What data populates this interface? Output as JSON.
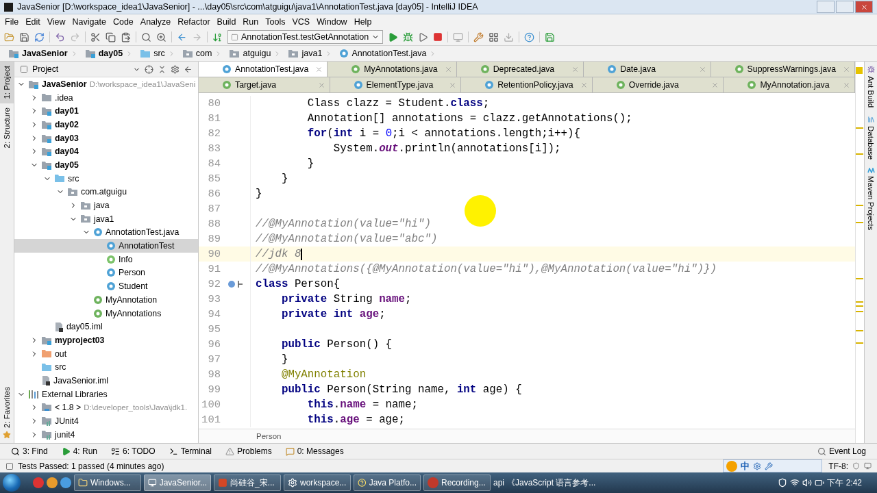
{
  "window": {
    "title": "JavaSenior [D:\\workspace_idea1\\JavaSenior] - ...\\day05\\src\\com\\atguigu\\java1\\AnnotationTest.java [day05] - IntelliJ IDEA"
  },
  "menu": [
    "File",
    "Edit",
    "View",
    "Navigate",
    "Code",
    "Analyze",
    "Refactor",
    "Build",
    "Run",
    "Tools",
    "VCS",
    "Window",
    "Help"
  ],
  "toolbar": {
    "run_config": "AnnotationTest.testGetAnnotation"
  },
  "nav_bar": [
    {
      "label": "JavaSenior",
      "kind": "module"
    },
    {
      "label": "day05",
      "kind": "module"
    },
    {
      "label": "src",
      "kind": "source"
    },
    {
      "label": "com",
      "kind": "package"
    },
    {
      "label": "atguigu",
      "kind": "package"
    },
    {
      "label": "java1",
      "kind": "package"
    },
    {
      "label": "AnnotationTest.java",
      "kind": "class"
    }
  ],
  "left_strip": {
    "top": [
      {
        "label": "1: Project",
        "selected": true
      },
      {
        "label": "2: Structure",
        "selected": false
      }
    ],
    "bottom": [
      {
        "label": "2: Favorites",
        "selected": false
      }
    ]
  },
  "project": {
    "title": "Project",
    "tree": [
      {
        "label": "JavaSenior",
        "kind": "module",
        "bold": true,
        "hint": "D:\\workspace_idea1\\JavaSeni",
        "expanded": true,
        "selected": false,
        "children": [
          {
            "label": ".idea",
            "kind": "folder",
            "expanded": false,
            "selected": false
          },
          {
            "label": "day01",
            "kind": "module",
            "bold": true,
            "expanded": false,
            "selected": false
          },
          {
            "label": "day02",
            "kind": "module",
            "bold": true,
            "expanded": false,
            "selected": false
          },
          {
            "label": "day03",
            "kind": "module",
            "bold": true,
            "expanded": false,
            "selected": false
          },
          {
            "label": "day04",
            "kind": "module",
            "bold": true,
            "expanded": false,
            "selected": false
          },
          {
            "label": "day05",
            "kind": "module",
            "bold": true,
            "expanded": true,
            "selected": false,
            "children": [
              {
                "label": "src",
                "kind": "source",
                "expanded": true,
                "selected": false,
                "children": [
                  {
                    "label": "com.atguigu",
                    "kind": "package",
                    "expanded": true,
                    "selected": false,
                    "children": [
                      {
                        "label": "java",
                        "kind": "package",
                        "expanded": false,
                        "selected": false
                      },
                      {
                        "label": "java1",
                        "kind": "package",
                        "expanded": true,
                        "selected": false,
                        "children": [
                          {
                            "label": "AnnotationTest.java",
                            "kind": "class",
                            "expanded": true,
                            "selected": false,
                            "children": [
                              {
                                "label": "AnnotationTest",
                                "kind": "class",
                                "selected": true
                              },
                              {
                                "label": "Info",
                                "kind": "interface",
                                "selected": false
                              },
                              {
                                "label": "Person",
                                "kind": "class",
                                "selected": false
                              },
                              {
                                "label": "Student",
                                "kind": "class",
                                "selected": false
                              }
                            ]
                          },
                          {
                            "label": "MyAnnotation",
                            "kind": "annotation",
                            "selected": false
                          },
                          {
                            "label": "MyAnnotations",
                            "kind": "annotation",
                            "selected": false
                          }
                        ]
                      }
                    ]
                  }
                ]
              },
              {
                "label": "day05.iml",
                "kind": "iml",
                "selected": false
              }
            ]
          },
          {
            "label": "myproject03",
            "kind": "module",
            "bold": true,
            "expanded": false,
            "selected": false
          },
          {
            "label": "out",
            "kind": "excluded",
            "expanded": false,
            "selected": false
          },
          {
            "label": "src",
            "kind": "source",
            "selected": false
          },
          {
            "label": "JavaSenior.iml",
            "kind": "iml",
            "selected": false
          }
        ]
      },
      {
        "label": "External Libraries",
        "kind": "libraries",
        "expanded": true,
        "selected": false,
        "children": [
          {
            "label": "< 1.8 >",
            "kind": "jdk",
            "hint": "D:\\developer_tools\\Java\\jdk1.",
            "expanded": false,
            "selected": false
          },
          {
            "label": "JUnit4",
            "kind": "library",
            "expanded": false,
            "selected": false
          },
          {
            "label": "junit4",
            "kind": "library",
            "expanded": false,
            "selected": false
          }
        ]
      }
    ]
  },
  "tab_rows": [
    [
      {
        "label": "AnnotationTest.java",
        "kind": "class",
        "selected": true
      },
      {
        "label": "MyAnnotations.java",
        "kind": "annotation",
        "selected": false
      },
      {
        "label": "Deprecated.java",
        "kind": "annotation",
        "selected": false
      },
      {
        "label": "Date.java",
        "kind": "class",
        "selected": false
      },
      {
        "label": "SuppressWarnings.java",
        "kind": "annotation",
        "selected": false
      }
    ],
    [
      {
        "label": "Target.java",
        "kind": "annotation",
        "selected": false
      },
      {
        "label": "ElementType.java",
        "kind": "enum",
        "selected": false
      },
      {
        "label": "RetentionPolicy.java",
        "kind": "enum",
        "selected": false
      },
      {
        "label": "Override.java",
        "kind": "annotation",
        "selected": false
      },
      {
        "label": "MyAnnotation.java",
        "kind": "annotation",
        "selected": false
      }
    ]
  ],
  "editor": {
    "lines": [
      {
        "number": "80",
        "current": false,
        "tokens": [
          {
            "kind": "t",
            "text": "        Class clazz = Student."
          },
          {
            "kind": "k",
            "text": "class"
          },
          {
            "kind": "t",
            "text": ";"
          }
        ]
      },
      {
        "number": "81",
        "current": false,
        "tokens": [
          {
            "kind": "t",
            "text": "        Annotation[] annotations = clazz.getAnnotations();"
          }
        ]
      },
      {
        "number": "82",
        "current": false,
        "tokens": [
          {
            "kind": "k",
            "text": "        for"
          },
          {
            "kind": "t",
            "text": "("
          },
          {
            "kind": "k",
            "text": "int"
          },
          {
            "kind": "t",
            "text": " i = "
          },
          {
            "kind": "n",
            "text": "0"
          },
          {
            "kind": "t",
            "text": ";i < annotations.length;i++){"
          }
        ]
      },
      {
        "number": "83",
        "current": false,
        "tokens": [
          {
            "kind": "t",
            "text": "            System."
          },
          {
            "kind": "s",
            "text": "out"
          },
          {
            "kind": "t",
            "text": ".println(annotations[i]);"
          }
        ]
      },
      {
        "number": "84",
        "current": false,
        "tokens": [
          {
            "kind": "t",
            "text": "        }"
          }
        ]
      },
      {
        "number": "85",
        "current": false,
        "tokens": [
          {
            "kind": "t",
            "text": "    }"
          }
        ]
      },
      {
        "number": "86",
        "current": false,
        "tokens": [
          {
            "kind": "t",
            "text": "}"
          }
        ]
      },
      {
        "number": "87",
        "current": false
      },
      {
        "number": "88",
        "current": false,
        "tokens": [
          {
            "kind": "c",
            "text": "//@MyAnnotation(value=\"hi\")"
          }
        ]
      },
      {
        "number": "89",
        "current": false,
        "tokens": [
          {
            "kind": "c",
            "text": "//@MyAnnotation(value=\"abc\")"
          }
        ]
      },
      {
        "number": "90",
        "current": true,
        "tokens": [
          {
            "kind": "c",
            "text": "//jdk 8"
          }
        ]
      },
      {
        "number": "91",
        "current": false,
        "tokens": [
          {
            "kind": "c",
            "text": "//@MyAnnotations({@MyAnnotation(value=\"hi\"),@MyAnnotation(value=\"hi\")})"
          }
        ]
      },
      {
        "number": "92",
        "current": false,
        "tokens": [
          {
            "kind": "k",
            "text": "class"
          },
          {
            "kind": "t",
            "text": " Person{"
          }
        ]
      },
      {
        "number": "93",
        "current": false,
        "tokens": [
          {
            "kind": "k",
            "text": "    private"
          },
          {
            "kind": "t",
            "text": " String "
          },
          {
            "kind": "f",
            "text": "name"
          },
          {
            "kind": "t",
            "text": ";"
          }
        ]
      },
      {
        "number": "94",
        "current": false,
        "tokens": [
          {
            "kind": "k",
            "text": "    private int "
          },
          {
            "kind": "f",
            "text": "age"
          },
          {
            "kind": "t",
            "text": ";"
          }
        ]
      },
      {
        "number": "95",
        "current": false
      },
      {
        "number": "96",
        "current": false,
        "tokens": [
          {
            "kind": "k",
            "text": "    public"
          },
          {
            "kind": "t",
            "text": " Person() {"
          }
        ]
      },
      {
        "number": "97",
        "current": false,
        "tokens": [
          {
            "kind": "t",
            "text": "    }"
          }
        ]
      },
      {
        "number": "98",
        "current": false,
        "tokens": [
          {
            "kind": "a",
            "text": "    @MyAnnotation"
          }
        ]
      },
      {
        "number": "99",
        "current": false,
        "tokens": [
          {
            "kind": "k",
            "text": "    public"
          },
          {
            "kind": "t",
            "text": " Person(String name, "
          },
          {
            "kind": "k",
            "text": "int"
          },
          {
            "kind": "t",
            "text": " age) {"
          }
        ]
      },
      {
        "number": "100",
        "current": false,
        "tokens": [
          {
            "kind": "k",
            "text": "        this"
          },
          {
            "kind": "t",
            "text": "."
          },
          {
            "kind": "f",
            "text": "name"
          },
          {
            "kind": "t",
            "text": " = name;"
          }
        ]
      },
      {
        "number": "101",
        "current": false,
        "tokens": [
          {
            "kind": "k",
            "text": "        this"
          },
          {
            "kind": "t",
            "text": "."
          },
          {
            "kind": "f",
            "text": "age"
          },
          {
            "kind": "t",
            "text": " = age;"
          }
        ]
      }
    ],
    "breadcrumb": "Person"
  },
  "right_strip": [
    {
      "label": "Ant Build",
      "kind": "ant"
    },
    {
      "label": "Database",
      "kind": "database"
    },
    {
      "label": "Maven Projects",
      "kind": "maven"
    }
  ],
  "tool_windows": [
    {
      "label": "3: Find",
      "kind": "find"
    },
    {
      "label": "4: Run",
      "kind": "run"
    },
    {
      "label": "6: TODO",
      "kind": "todo"
    },
    {
      "label": "Terminal",
      "kind": "terminal"
    },
    {
      "label": "Problems",
      "kind": "problems"
    },
    {
      "label": "0: Messages",
      "kind": "messages"
    }
  ],
  "event_log": "Event Log",
  "status": {
    "message": "Tests Passed: 1 passed (4 minutes ago)",
    "encoding": "TF-8:"
  },
  "ime": {
    "label": "中"
  },
  "taskbar": {
    "items": [
      {
        "label": "Windows...",
        "kind": "explorer",
        "selected": false
      },
      {
        "label": "JavaSenior...",
        "kind": "idea",
        "selected": true
      },
      {
        "label": "尚硅谷_宋...",
        "kind": "ppt",
        "selected": false
      },
      {
        "label": "workspace...",
        "kind": "app",
        "selected": false
      },
      {
        "label": "Java Platfo...",
        "kind": "help",
        "selected": false
      },
      {
        "label": "Recording...",
        "kind": "record",
        "selected": false
      }
    ],
    "extra": "api",
    "doc": "《JavaScript 语言参考...",
    "clock": "下午 2:42"
  }
}
